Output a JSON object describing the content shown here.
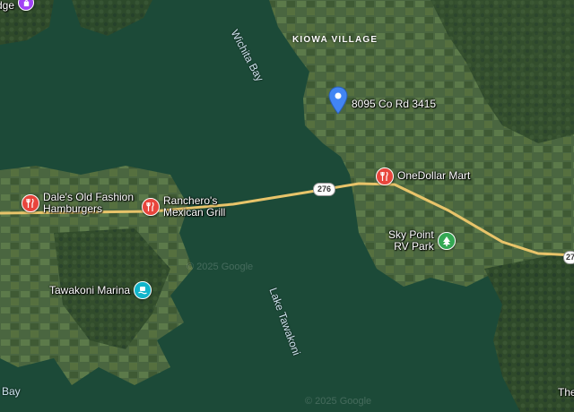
{
  "map": {
    "places": {
      "dales": {
        "line1": "Dale's Old Fashion",
        "line2": "Hamburgers"
      },
      "rancheros": {
        "line1": "Ranchero's",
        "line2": "Mexican Grill"
      },
      "onedollar": {
        "label": "OneDollar Mart"
      },
      "skypoint": {
        "line1": "Sky Point",
        "line2": "RV Park"
      },
      "marina": {
        "label": "Tawakoni Marina"
      },
      "address": {
        "label": "8095 Co Rd 3415"
      },
      "edge_top_left": {
        "label": "dge"
      }
    },
    "area_labels": {
      "kiowa": "KIOWA VILLAGE",
      "wichita_bay": "Wichita Bay",
      "lake_tawakoni": "Lake Tawakoni",
      "bay": "Bay",
      "edge_bottom_right": "The"
    },
    "roads": {
      "hwy276": "276",
      "edge_shield": "27"
    },
    "copyright": {
      "top": "© 2025 Google",
      "bottom": "© 2025 Google"
    },
    "colors": {
      "water": "#1c4a38",
      "land": "#3d5a35",
      "restaurant_pin": "#e8453c",
      "park_pin": "#34a853",
      "transit_pin": "#12b5cb",
      "address_pin": "#4285f4",
      "road": "#e8c46a"
    },
    "icons": [
      "utensils-icon",
      "tree-icon",
      "ferry-icon",
      "location-pin-icon",
      "shopping-icon"
    ]
  }
}
